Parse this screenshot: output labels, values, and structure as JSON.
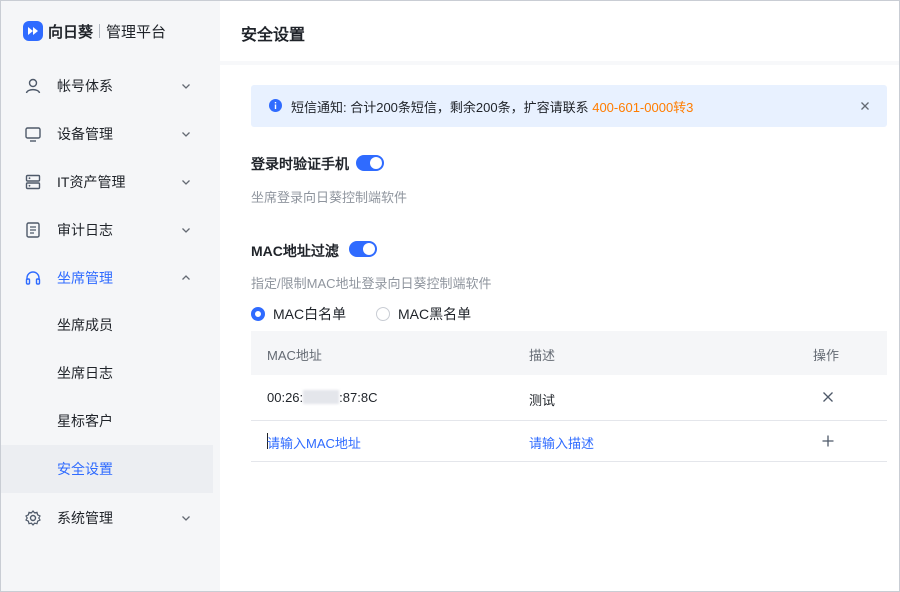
{
  "brand": {
    "name": "向日葵",
    "subtitle": "管理平台"
  },
  "sidebar": {
    "items": [
      {
        "label": "帐号体系",
        "icon": "user-icon"
      },
      {
        "label": "设备管理",
        "icon": "monitor-icon"
      },
      {
        "label": "IT资产管理",
        "icon": "server-icon"
      },
      {
        "label": "审计日志",
        "icon": "document-icon"
      },
      {
        "label": "坐席管理",
        "icon": "headset-icon",
        "expanded": true,
        "active": true
      },
      {
        "label": "系统管理",
        "icon": "gear-icon"
      }
    ],
    "subitems": [
      {
        "label": "坐席成员"
      },
      {
        "label": "坐席日志"
      },
      {
        "label": "星标客户"
      },
      {
        "label": "安全设置",
        "selected": true
      }
    ]
  },
  "main": {
    "title": "安全设置",
    "notice": {
      "text": "短信通知: 合计200条短信，剩余200条，扩容请联系 ",
      "highlight": "400-601-0000转3"
    },
    "phone_verify": {
      "title": "登录时验证手机",
      "enabled": true,
      "desc": "坐席登录向日葵控制端软件"
    },
    "mac_filter": {
      "title": "MAC地址过滤",
      "enabled": true,
      "desc": "指定/限制MAC地址登录向日葵控制端软件",
      "options": [
        "MAC白名单",
        "MAC黑名单"
      ],
      "selected": "MAC白名单"
    },
    "table": {
      "headers": [
        "MAC地址",
        "描述",
        "操作"
      ],
      "rows": [
        {
          "mac_prefix": "00:26:",
          "mac_suffix": ":87:8C",
          "desc": "测试"
        }
      ],
      "input": {
        "mac_placeholder": "请输入MAC地址",
        "desc_placeholder": "请输入描述"
      }
    }
  },
  "colors": {
    "accent": "#2f6bff",
    "highlight": "#ff7d00",
    "notice_bg": "#e8f1ff"
  }
}
